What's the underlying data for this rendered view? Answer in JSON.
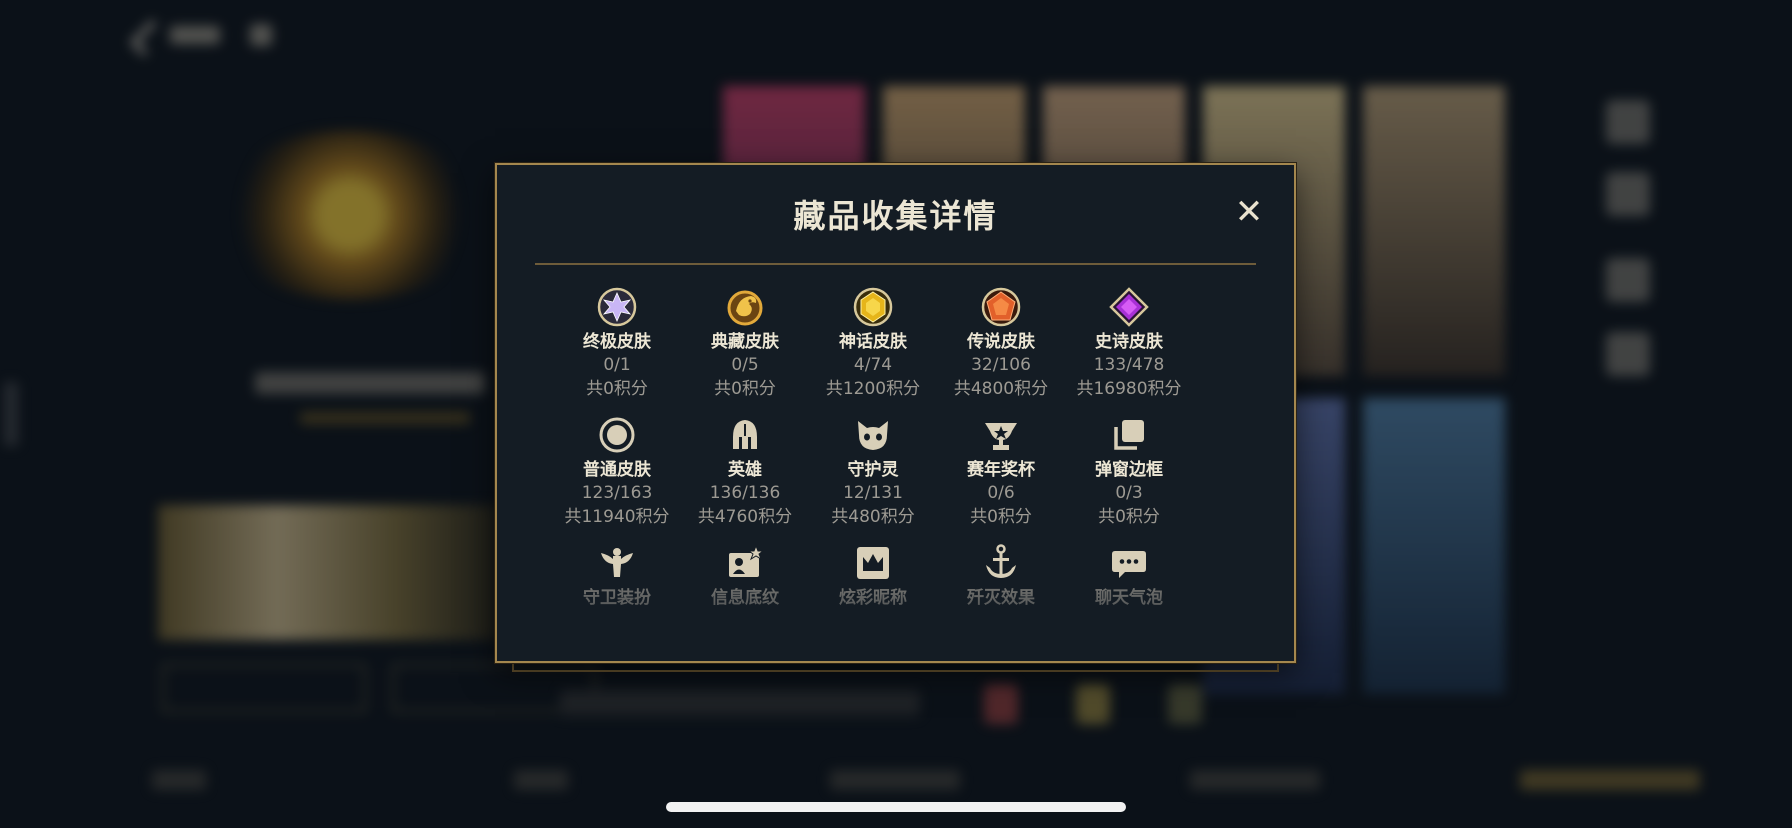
{
  "modal": {
    "title": "藏品收集详情",
    "close_label": "✕"
  },
  "items": [
    {
      "name": "终极皮肤",
      "count": "0/1",
      "points": "共0积分",
      "icon": "ultimate-gem-icon",
      "color": "#b9a6f0"
    },
    {
      "name": "典藏皮肤",
      "count": "0/5",
      "points": "共0积分",
      "icon": "dragon-emblem-icon",
      "color": "#d9a23a"
    },
    {
      "name": "神话皮肤",
      "count": "4/74",
      "points": "共1200积分",
      "icon": "mythic-gem-icon",
      "color": "#e8b81c"
    },
    {
      "name": "传说皮肤",
      "count": "32/106",
      "points": "共4800积分",
      "icon": "legendary-gem-icon",
      "color": "#e0622a"
    },
    {
      "name": "史诗皮肤",
      "count": "133/478",
      "points": "共16980积分",
      "icon": "epic-gem-icon",
      "color": "#a62fd0"
    },
    {
      "name": "普通皮肤",
      "count": "123/163",
      "points": "共11940积分",
      "icon": "circle-icon",
      "color": "#d8cfb8"
    },
    {
      "name": "英雄",
      "count": "136/136",
      "points": "共4760积分",
      "icon": "helmet-icon",
      "color": "#d8cfb8"
    },
    {
      "name": "守护灵",
      "count": "12/131",
      "points": "共480积分",
      "icon": "guardian-icon",
      "color": "#d8cfb8"
    },
    {
      "name": "赛年奖杯",
      "count": "0/6",
      "points": "共0积分",
      "icon": "trophy-icon",
      "color": "#d8cfb8"
    },
    {
      "name": "弹窗边框",
      "count": "0/3",
      "points": "共0积分",
      "icon": "frame-icon",
      "color": "#d8cfb8"
    },
    {
      "name": "守卫装扮",
      "icon": "ward-icon",
      "color": "#d8cfb8"
    },
    {
      "name": "信息底纹",
      "icon": "profile-card-icon",
      "color": "#d8cfb8"
    },
    {
      "name": "炫彩昵称",
      "icon": "crown-nameplate-icon",
      "color": "#d8cfb8"
    },
    {
      "name": "歼灭效果",
      "icon": "anchor-icon",
      "color": "#d8cfb8"
    },
    {
      "name": "聊天气泡",
      "icon": "chat-bubble-icon",
      "color": "#d8cfb8"
    }
  ],
  "colors": {
    "modal_border": "#a4874e",
    "modal_bg": "#141c24",
    "title": "#ece6d4"
  }
}
